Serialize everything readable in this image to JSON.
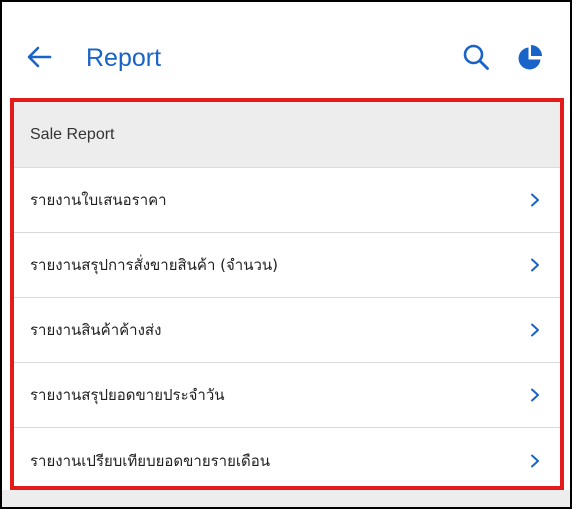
{
  "header": {
    "title": "Report",
    "back_icon": "arrow-left-icon",
    "search_icon": "search-icon",
    "chart_icon": "pie-chart-icon"
  },
  "colors": {
    "accent": "#1a63c8",
    "highlight_border": "#e41b1b",
    "section_bg": "#ededed"
  },
  "section": {
    "title": "Sale Report",
    "items": [
      {
        "label": "รายงานใบเสนอราคา"
      },
      {
        "label": "รายงานสรุปการสั่งขายสินค้า (จำนวน)"
      },
      {
        "label": "รายงานสินค้าค้างส่ง"
      },
      {
        "label": "รายงานสรุปยอดขายประจำวัน"
      },
      {
        "label": "รายงานเปรียบเทียบยอดขายรายเดือน"
      }
    ]
  }
}
